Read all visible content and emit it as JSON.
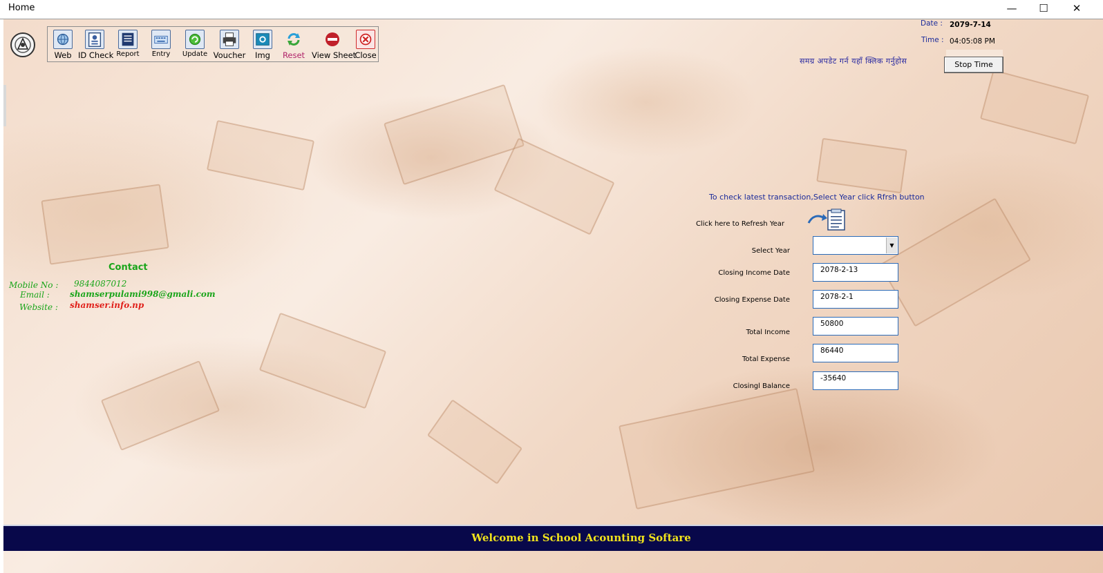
{
  "window": {
    "title": "Home",
    "controls": {
      "minimize": "—",
      "maximize": "☐",
      "close": "✕"
    }
  },
  "toolbar": [
    {
      "key": "web",
      "label": "Web",
      "icon": "web-icon",
      "color": "#4a7fc1"
    },
    {
      "key": "id-check",
      "label": "ID Check",
      "icon": "id-card-icon",
      "color": "#3a5fa0"
    },
    {
      "key": "report",
      "label": "Report",
      "icon": "report-icon",
      "color": "#203a70"
    },
    {
      "key": "entry",
      "label": "Entry",
      "icon": "keyboard-icon",
      "color": "#4a8ac8"
    },
    {
      "key": "update",
      "label": "Update",
      "icon": "update-icon",
      "color": "#3aa63a"
    },
    {
      "key": "voucher",
      "label": "Voucher",
      "icon": "printer-icon",
      "color": "#333333"
    },
    {
      "key": "img",
      "label": "Img",
      "icon": "image-icon",
      "color": "#1a8ab8"
    },
    {
      "key": "reset",
      "label": "Reset",
      "icon": "refresh-icon",
      "color": "#2aa0d8"
    },
    {
      "key": "view-sheet",
      "label": "View Sheet",
      "icon": "exit-icon",
      "color": "#c0202a"
    },
    {
      "key": "close",
      "label": "Close",
      "icon": "close-icon",
      "color": "#d02a2a"
    }
  ],
  "datetime": {
    "date_label": "Date :",
    "date_value": "2079-7-14",
    "time_label": "Time :",
    "time_value": "04:05:08 PM"
  },
  "nepali_notice": "समग्र अपडेट गर्न यहाँ क्लिक गर्नुहोस",
  "stop_time_label": "Stop Time",
  "form": {
    "hint": "To check latest transaction,Select Year click  Rfrsh button",
    "refresh_label": "Click here to Refresh Year",
    "select_year_label": "Select Year",
    "select_year_value": "",
    "closing_income_date_label": "Closing Income Date",
    "closing_income_date": "2078-2-13",
    "closing_expense_date_label": "Closing Expense Date",
    "closing_expense_date": "2078-2-1",
    "total_income_label": "Total Income",
    "total_income": "50800",
    "total_expense_label": "Total Expense",
    "total_expense": "86440",
    "closing_balance_label": "Closingl Balance",
    "closing_balance": "-35640"
  },
  "contact": {
    "heading": "Contact",
    "mobile_label": "Mobile No :",
    "mobile": "9844087012",
    "email_label": "Email  :",
    "email": "shamserpulami998@gmali.com",
    "website_label": "Website :",
    "website": "shamser.info.np"
  },
  "footer": {
    "welcome": "Welcome in School Acounting Softare"
  }
}
